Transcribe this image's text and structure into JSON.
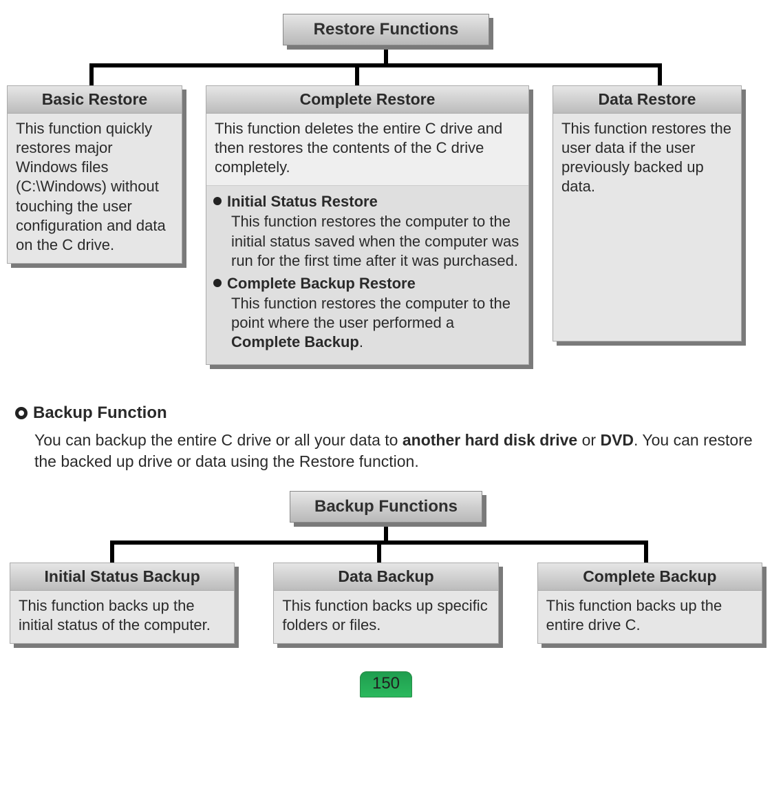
{
  "restore": {
    "root": "Restore Functions",
    "cards": [
      {
        "title": "Basic Restore",
        "body": "This function quickly restores major Windows files (C:\\Windows) without touching the user configuration and data on the C drive."
      },
      {
        "title": "Complete Restore",
        "body": "This function deletes the entire C drive and then restores the contents of the C drive completely.",
        "subs": [
          {
            "title": "Initial Status Restore",
            "desc": "This function restores the computer to the initial status saved when the computer was run for the first time after it was purchased."
          },
          {
            "title": "Complete Backup Restore",
            "desc_pre": "This function restores the computer to the point where the user performed a ",
            "desc_bold": "Complete Backup",
            "desc_post": "."
          }
        ]
      },
      {
        "title": "Data Restore",
        "body": "This function restores the user data if the user previously backed up data."
      }
    ]
  },
  "backup_section": {
    "heading": "Backup Function",
    "para_pre": "You can backup the entire C drive or all your data to ",
    "para_bold1": "another hard disk drive",
    "para_mid": " or ",
    "para_bold2": "DVD",
    "para_post": ". You can restore the backed up drive or data using the Restore function."
  },
  "backup": {
    "root": "Backup Functions",
    "cards": [
      {
        "title": "Initial Status Backup",
        "body": "This function backs up the initial status of the computer."
      },
      {
        "title": "Data Backup",
        "body": "This function backs up specific folders or files."
      },
      {
        "title": "Complete Backup",
        "body": "This function backs up the entire drive C."
      }
    ]
  },
  "page_number": "150"
}
